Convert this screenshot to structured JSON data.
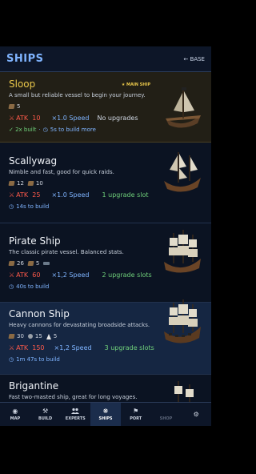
{
  "header": {
    "title": "SHIPS",
    "back_label": "← BASE"
  },
  "ships": [
    {
      "name": "Sloop",
      "badge": "★ MAIN SHIP",
      "description": "A small but reliable vessel to begin your journey.",
      "resources": [
        {
          "icon": "wood-icon",
          "value": "5"
        }
      ],
      "atk_label": "ATK",
      "atk_value": "10",
      "speed": "×1.0 Speed",
      "upgrades": "No upgrades",
      "built": "✓ 2x built",
      "build_time": "5s to build more"
    },
    {
      "name": "Scallywag",
      "description": "Nimble and fast, good for quick raids.",
      "resources": [
        {
          "icon": "wood-icon",
          "value": "12"
        },
        {
          "icon": "wood-icon",
          "value": "10"
        }
      ],
      "atk_label": "ATK",
      "atk_value": "25",
      "speed": "×1.0 Speed",
      "upgrades": "1 upgrade slot",
      "build_time": "14s to build"
    },
    {
      "name": "Pirate Ship",
      "description": "The classic pirate vessel. Balanced stats.",
      "resources": [
        {
          "icon": "wood-icon",
          "value": "26"
        },
        {
          "icon": "wood-icon",
          "value": "5"
        },
        {
          "icon": "plank-icon",
          "value": ""
        }
      ],
      "atk_label": "ATK",
      "atk_value": "60",
      "speed": "×1,2 Speed",
      "upgrades": "2 upgrade slots",
      "build_time": "40s to build"
    },
    {
      "name": "Cannon Ship",
      "description": "Heavy cannons for devastating broadside attacks.",
      "resources": [
        {
          "icon": "wood-icon",
          "value": "30"
        },
        {
          "icon": "cannon-icon",
          "value": "15"
        },
        {
          "icon": "sail-icon",
          "value": "5"
        }
      ],
      "atk_label": "ATK",
      "atk_value": "150",
      "speed": "×1,2 Speed",
      "upgrades": "3 upgrade slots",
      "build_time": "1m 47s to build"
    },
    {
      "name": "Brigantine",
      "description": "Fast two-masted ship, great for long voyages."
    }
  ],
  "nav": [
    {
      "label": "MAP",
      "icon": "map-icon",
      "glyph": "◉"
    },
    {
      "label": "BUILD",
      "icon": "hammer-icon",
      "glyph": "⚒"
    },
    {
      "label": "EXPERTS",
      "icon": "experts-icon",
      "glyph": "👥"
    },
    {
      "label": "SHIPS",
      "icon": "ship-wheel-icon",
      "glyph": "❋"
    },
    {
      "label": "PORT",
      "icon": "flag-icon",
      "glyph": "⚑"
    },
    {
      "label": "SHOP",
      "icon": "shop-icon",
      "glyph": ""
    },
    {
      "label": "",
      "icon": "gear-icon",
      "glyph": "⚙"
    }
  ],
  "colors": {
    "accent": "#7fb4ff",
    "gold": "#e8c64a",
    "attack": "#ff5a4a",
    "upgrade": "#6fd07a",
    "background": "#0b1322"
  }
}
